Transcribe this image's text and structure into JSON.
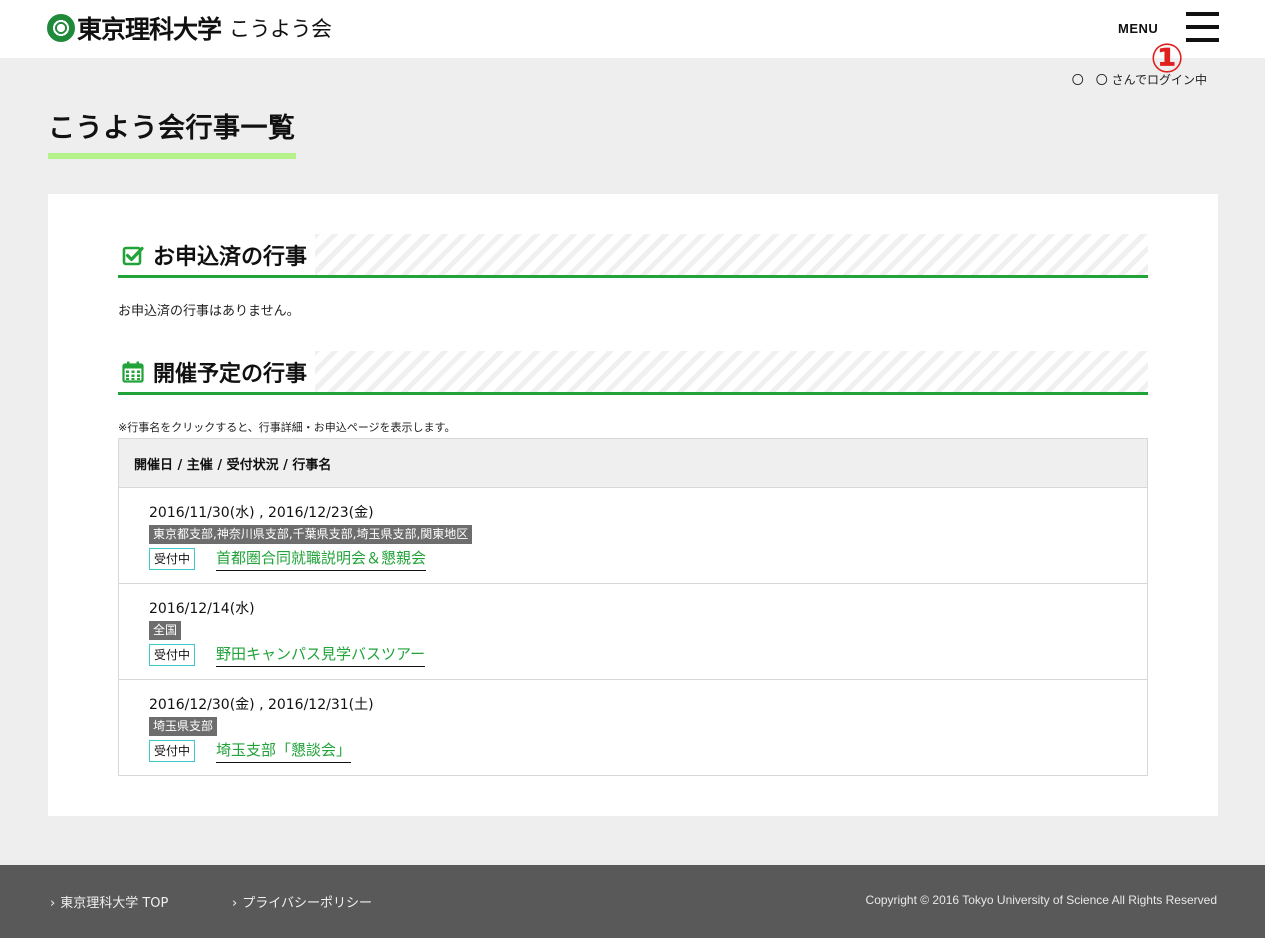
{
  "header": {
    "logo_main": "東京理科大学",
    "logo_sub": "こうよう会",
    "menu_label": "MENU",
    "annotation": "①",
    "login_status": "〇　〇 さんでログイン中"
  },
  "page_title": "こうよう会行事一覧",
  "applied": {
    "title": "お申込済の行事",
    "empty_message": "お申込済の行事はありません。"
  },
  "upcoming": {
    "title": "開催予定の行事",
    "note": "※行事名をクリックすると、行事詳細・お申込ページを表示します。",
    "table_header": "開催日 / 主催 / 受付状況 / 行事名",
    "events": [
      {
        "date": "2016/11/30(水) , 2016/12/23(金)",
        "host": "東京都支部,神奈川県支部,千葉県支部,埼玉県支部,関東地区",
        "status": "受付中",
        "name": "首都圏合同就職説明会＆懇親会"
      },
      {
        "date": "2016/12/14(水)",
        "host": "全国",
        "status": "受付中",
        "name": "野田キャンパス見学バスツアー"
      },
      {
        "date": "2016/12/30(金) , 2016/12/31(土)",
        "host": "埼玉県支部",
        "status": "受付中",
        "name": "埼玉支部「懇談会」"
      }
    ]
  },
  "footer": {
    "link_top": "東京理科大学 TOP",
    "link_privacy": "プライバシーポリシー",
    "copyright": "Copyright © 2016 Tokyo University of Science All Rights Reserved"
  },
  "colors": {
    "accent_green": "#21a33a",
    "title_underline": "#b6f28a",
    "badge_border": "#3cc9c9",
    "annotation_red": "#e0201e",
    "footer_bg": "#595959"
  },
  "icons": {
    "applied": "check-square-icon",
    "upcoming": "calendar-icon",
    "menu": "hamburger-icon"
  }
}
